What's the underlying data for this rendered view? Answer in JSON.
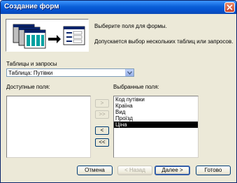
{
  "window": {
    "title": "Создание форм"
  },
  "intro": {
    "line1": "Выберите поля для формы.",
    "line2": "Допускается выбор нескольких таблиц или запросов."
  },
  "tables": {
    "label": "Таблицы и запросы",
    "selected": "Таблица: Путівки"
  },
  "available": {
    "label": "Доступные поля:",
    "items": []
  },
  "selected_fields": {
    "label": "Выбранные поля:",
    "items": [
      "Код путівки",
      "Країна",
      "Вид",
      "Проїзд",
      "Ціна"
    ],
    "highlighted": "Ціна"
  },
  "move_buttons": {
    "add_one": ">",
    "add_all": ">>",
    "remove_one": "<",
    "remove_all": "<<"
  },
  "footer": {
    "cancel": "Отмена",
    "back": "< Назад",
    "next": "Далее >",
    "finish": "Готово"
  },
  "icons": {
    "wizard_illustration": "form-wizard-illustration",
    "combo_arrow": "chevron-down-icon",
    "close": "close-icon"
  },
  "colors": {
    "titlebar": "#0a5fd8",
    "dialog_bg": "#ece9d8",
    "selection": "#000000"
  }
}
